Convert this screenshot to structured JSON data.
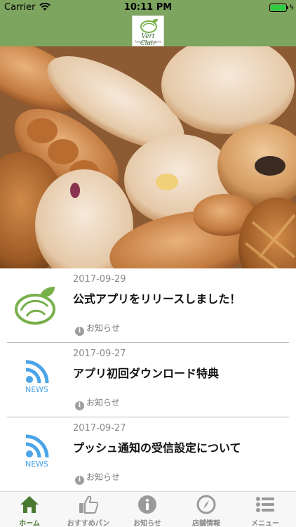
{
  "status_bar": {
    "carrier": "Carrier",
    "time": "10:11 PM"
  },
  "header": {
    "logo_text": "Vert Clair",
    "logo_sub": "Pain & Boulangerie"
  },
  "news": [
    {
      "date": "2017-09-29",
      "title": "公式アプリをリリースしました！",
      "category": "お知らせ",
      "thumb": "logo-icon"
    },
    {
      "date": "2017-09-27",
      "title": "アプリ初回ダウンロード特典",
      "category": "お知らせ",
      "thumb": "rss-icon",
      "thumb_label": "NEWS"
    },
    {
      "date": "2017-09-27",
      "title": "プッシュ通知の受信設定について",
      "category": "お知らせ",
      "thumb": "rss-icon",
      "thumb_label": "NEWS"
    }
  ],
  "tabs": [
    {
      "label": "ホーム",
      "icon": "home-icon",
      "active": true
    },
    {
      "label": "おすすめパン",
      "icon": "thumbs-up-icon",
      "active": false
    },
    {
      "label": "お知らせ",
      "icon": "info-icon",
      "active": false
    },
    {
      "label": "店舗情報",
      "icon": "compass-icon",
      "active": false
    },
    {
      "label": "メニュー",
      "icon": "list-icon",
      "active": false
    }
  ],
  "colors": {
    "header_green": "#7ea55f",
    "active_tab": "#4a7a32",
    "news_blue": "#4ba4e8"
  }
}
